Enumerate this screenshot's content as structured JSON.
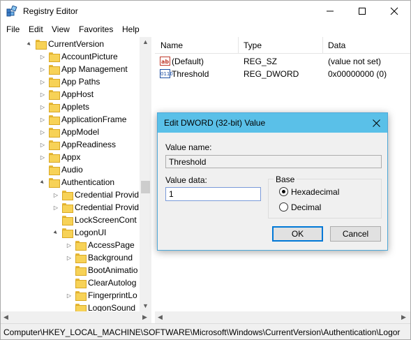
{
  "title": "Registry Editor",
  "menu": [
    "File",
    "Edit",
    "View",
    "Favorites",
    "Help"
  ],
  "tree": [
    {
      "label": "CurrentVersion",
      "depth": 0,
      "arrow": "▲"
    },
    {
      "label": "AccountPicture",
      "depth": 1,
      "arrow": "▷"
    },
    {
      "label": "App Management",
      "depth": 1,
      "arrow": "▷"
    },
    {
      "label": "App Paths",
      "depth": 1,
      "arrow": "▷"
    },
    {
      "label": "AppHost",
      "depth": 1,
      "arrow": "▷"
    },
    {
      "label": "Applets",
      "depth": 1,
      "arrow": "▷"
    },
    {
      "label": "ApplicationFrame",
      "depth": 1,
      "arrow": "▷"
    },
    {
      "label": "AppModel",
      "depth": 1,
      "arrow": "▷"
    },
    {
      "label": "AppReadiness",
      "depth": 1,
      "arrow": "▷"
    },
    {
      "label": "Appx",
      "depth": 1,
      "arrow": "▷"
    },
    {
      "label": "Audio",
      "depth": 1,
      "arrow": ""
    },
    {
      "label": "Authentication",
      "depth": 1,
      "arrow": "▲"
    },
    {
      "label": "Credential Provid",
      "depth": 2,
      "arrow": "▷"
    },
    {
      "label": "Credential Provid",
      "depth": 2,
      "arrow": "▷"
    },
    {
      "label": "LockScreenCont",
      "depth": 2,
      "arrow": ""
    },
    {
      "label": "LogonUI",
      "depth": 2,
      "arrow": "▲"
    },
    {
      "label": "AccessPage",
      "depth": 3,
      "arrow": "▷"
    },
    {
      "label": "Background",
      "depth": 3,
      "arrow": "▷"
    },
    {
      "label": "BootAnimatio",
      "depth": 3,
      "arrow": ""
    },
    {
      "label": "ClearAutolog",
      "depth": 3,
      "arrow": ""
    },
    {
      "label": "FingerprintLo",
      "depth": 3,
      "arrow": "▷"
    },
    {
      "label": "LogonSound",
      "depth": 3,
      "arrow": ""
    }
  ],
  "list": {
    "columns": [
      "Name",
      "Type",
      "Data"
    ],
    "rows": [
      {
        "icon": "ab",
        "name": "(Default)",
        "type": "REG_SZ",
        "data": "(value not set)"
      },
      {
        "icon": "0110",
        "name": "Threshold",
        "type": "REG_DWORD",
        "data": "0x00000000 (0)"
      }
    ]
  },
  "status": "Computer\\HKEY_LOCAL_MACHINE\\SOFTWARE\\Microsoft\\Windows\\CurrentVersion\\Authentication\\Logor",
  "dialog": {
    "title": "Edit DWORD (32-bit) Value",
    "value_name_label": "Value name:",
    "value_name": "Threshold",
    "value_data_label": "Value data:",
    "value_data": "1",
    "base_label": "Base",
    "hex_label": "Hexadecimal",
    "dec_label": "Decimal",
    "base_selected": "Hexadecimal",
    "ok": "OK",
    "cancel": "Cancel"
  }
}
